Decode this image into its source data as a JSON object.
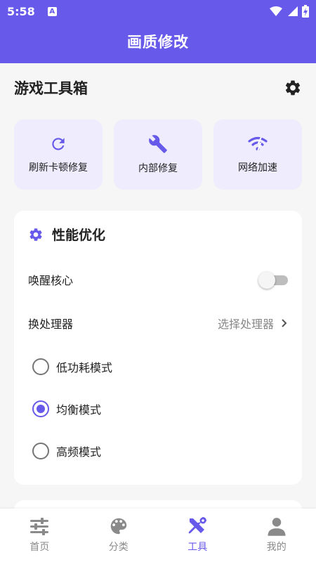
{
  "status_bar": {
    "time": "5:58",
    "notification_badge": "A",
    "icons": [
      "wifi-icon",
      "signal-icon",
      "battery-charging-icon"
    ]
  },
  "app_bar": {
    "title": "画质修改"
  },
  "toolbox": {
    "title": "游戏工具箱",
    "settings_icon": "gear-icon",
    "quick_actions": [
      {
        "label": "刷新卡顿修复",
        "icon": "refresh-icon"
      },
      {
        "label": "内部修复",
        "icon": "wrench-icon"
      },
      {
        "label": "网络加速",
        "icon": "wifi-boost-icon"
      }
    ]
  },
  "performance": {
    "title": "性能优化",
    "icon": "gear-icon",
    "wake_core": {
      "label": "唤醒核心",
      "enabled": false
    },
    "processor": {
      "label": "换处理器",
      "placeholder": "选择处理器"
    },
    "modes": [
      {
        "label": "低功耗模式",
        "selected": false
      },
      {
        "label": "均衡模式",
        "selected": true
      },
      {
        "label": "高频模式",
        "selected": false
      }
    ]
  },
  "bottom_nav": {
    "items": [
      {
        "label": "首页",
        "icon": "sliders-icon",
        "active": false
      },
      {
        "label": "分类",
        "icon": "palette-icon",
        "active": false
      },
      {
        "label": "工具",
        "icon": "tools-icon",
        "active": true
      },
      {
        "label": "我的",
        "icon": "person-icon",
        "active": false
      }
    ]
  },
  "colors": {
    "primary": "#6759ea",
    "card_tint": "#eeecfd",
    "background": "#f6f6f6",
    "inactive": "#8a8a8a"
  }
}
